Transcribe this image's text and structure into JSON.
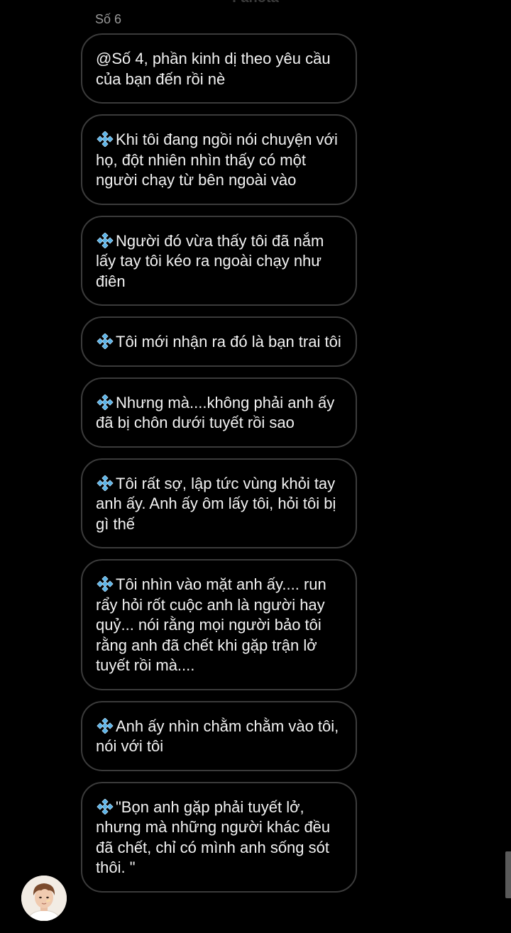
{
  "header": {
    "partial_title": "Fanota"
  },
  "thread": {
    "sender": "Số 6",
    "messages": [
      {
        "text": "@Số 4, phần kinh dị theo yêu cầu của bạn đến rồi nè",
        "has_icon": false
      },
      {
        "text": "Khi tôi đang ngồi nói chuyện với họ, đột nhiên nhìn thấy có một người chạy từ bên ngoài vào",
        "has_icon": true
      },
      {
        "text": "Người đó vừa thấy tôi đã nắm lấy tay tôi kéo ra ngoài chạy như điên",
        "has_icon": true
      },
      {
        "text": "Tôi mới nhận ra đó là bạn trai tôi",
        "has_icon": true
      },
      {
        "text": "Nhưng mà....không phải anh ấy đã bị chôn dưới tuyết rồi sao",
        "has_icon": true
      },
      {
        "text": "Tôi rất sợ, lập tức vùng khỏi tay anh ấy. Anh ấy ôm lấy tôi, hỏi tôi bị gì thế",
        "has_icon": true
      },
      {
        "text": "Tôi nhìn vào mặt anh ấy.... run rẩy hỏi rốt cuộc anh là người hay quỷ... nói rằng mọi người bảo tôi rằng anh đã chết khi gặp trận lở tuyết rồi mà....",
        "has_icon": true
      },
      {
        "text": "Anh ấy nhìn chằm chằm vào tôi, nói với tôi",
        "has_icon": true
      },
      {
        "text": "\"Bọn anh gặp phải tuyết lở, nhưng mà những người khác đều đã chết, chỉ có mình anh sống sót thôi. \"",
        "has_icon": true
      }
    ]
  },
  "colors": {
    "background": "#000000",
    "bubble_border": "#3b3b3b",
    "text": "#f2f2f2",
    "sender_name": "#9a9a9a",
    "diamond_icon": "#5ab4e8"
  },
  "icons": {
    "message_prefix": "blue-diamond-cluster-icon",
    "avatar": "user-avatar"
  }
}
